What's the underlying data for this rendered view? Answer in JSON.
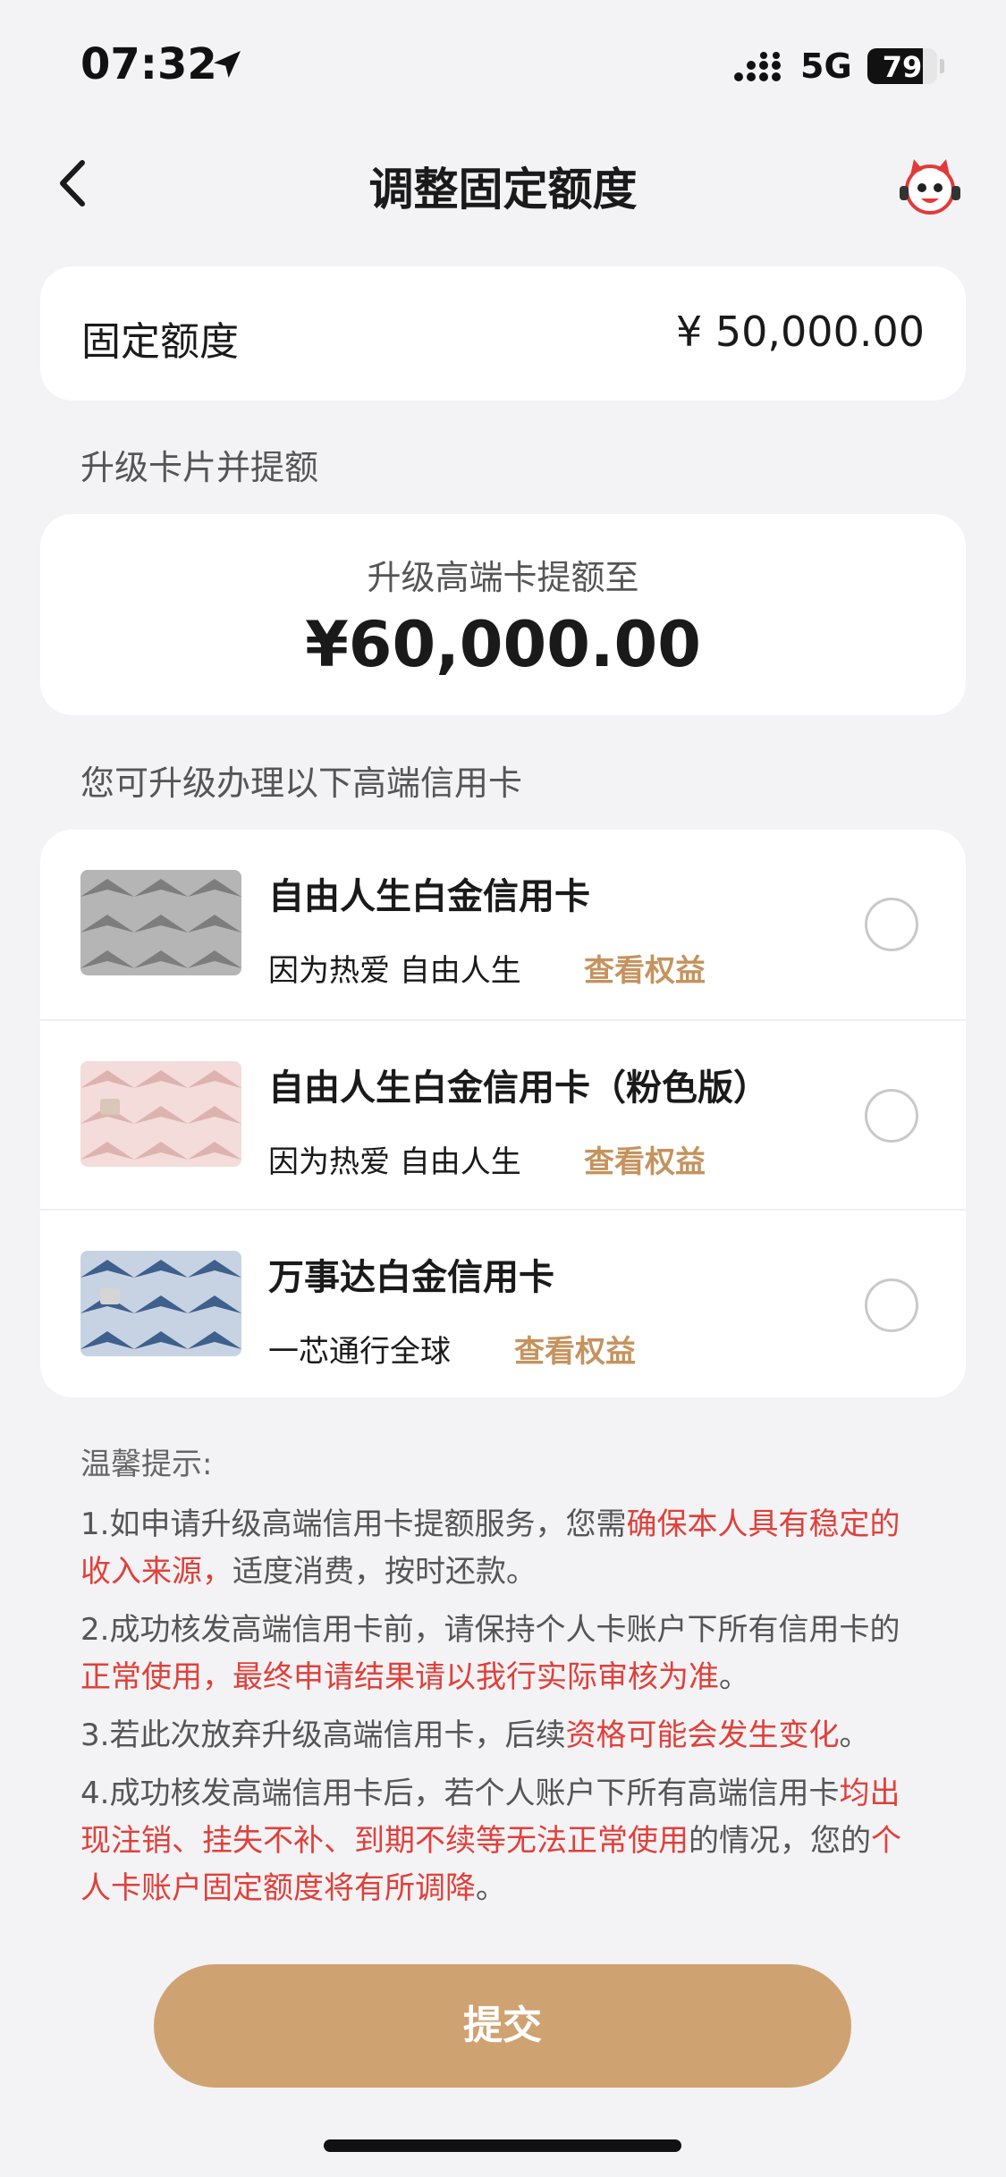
{
  "status_bar": {
    "time": "07:32",
    "network": "5G",
    "battery": "79",
    "battery_level": 0.79
  },
  "nav": {
    "title": "调整固定额度",
    "back_icon": "chevron-left-icon",
    "assistant_icon": "mascot-assistant-icon"
  },
  "fixed_limit": {
    "label": "固定额度",
    "value": "¥ 50,000.00"
  },
  "upgrade_section": {
    "title": "升级卡片并提额",
    "subtitle": "升级高端卡提额至",
    "amount": "¥60,000.00"
  },
  "cards_section": {
    "title": "您可升级办理以下高端信用卡",
    "cards": [
      {
        "name": "自由人生白金信用卡",
        "slogan": "因为热爱 自由人生",
        "link": "查看权益",
        "thumb_color": "#9a9a9a"
      },
      {
        "name": "自由人生白金信用卡（粉色版）",
        "slogan": "因为热爱 自由人生",
        "link": "查看权益",
        "thumb_color": "#e8c2c0"
      },
      {
        "name": "万事达白金信用卡",
        "slogan": "一芯通行全球",
        "link": "查看权益",
        "thumb_color": "#5f7fa6"
      }
    ]
  },
  "tips": {
    "title": "温馨提示:",
    "t1_a": "1.如申请升级高端信用卡提额服务，您需",
    "t1_b": "确保本人具有稳定的收入来源，",
    "t1_c": "适度消费，按时还款。",
    "t2_a": "2.成功核发高端信用卡前，请保持个人卡账户下所有信用卡的",
    "t2_b": "正常使用，最终申请结果请以我行实际审核为准",
    "t2_c": "。",
    "t3_a": "3.若此次放弃升级高端信用卡，后续",
    "t3_b": "资格可能会发生变化",
    "t3_c": "。",
    "t4_a": "4.成功核发高端信用卡后，若个人账户下所有高端信用卡",
    "t4_b": "均出现注销、挂失不补、到期不续等无法正常使用",
    "t4_c": "的情况，您的",
    "t4_d": "个人卡账户固定额度将有所调降",
    "t4_e": "。"
  },
  "submit": {
    "label": "提交"
  },
  "colors": {
    "accent": "#cfa271",
    "link": "#c5935e",
    "warning": "#e0403a"
  }
}
